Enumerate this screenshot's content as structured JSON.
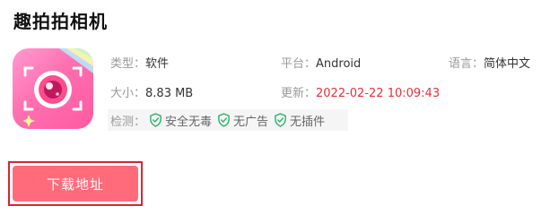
{
  "app": {
    "title": "趣拍拍相机",
    "icon": "camera-app-icon"
  },
  "meta": {
    "type_label": "类型：",
    "type_value": "软件",
    "platform_label": "平台：",
    "platform_value": "Android",
    "language_label": "语言：",
    "language_value": "简体中文",
    "size_label": "大小：",
    "size_value": "8.83 MB",
    "updated_label": "更新：",
    "updated_value": "2022-02-22 10:09:43"
  },
  "checks": {
    "label": "检测：",
    "items": [
      {
        "label": "安全无毒",
        "icon": "shield-check-icon"
      },
      {
        "label": "无广告",
        "icon": "shield-check-icon"
      },
      {
        "label": "无插件",
        "icon": "shield-check-icon"
      }
    ]
  },
  "download": {
    "label": "下载地址"
  },
  "colors": {
    "accent_red": "#e8303a",
    "button_pink": "#ff6b7b",
    "check_green": "#2db06c",
    "highlight_border": "#d9252d"
  }
}
